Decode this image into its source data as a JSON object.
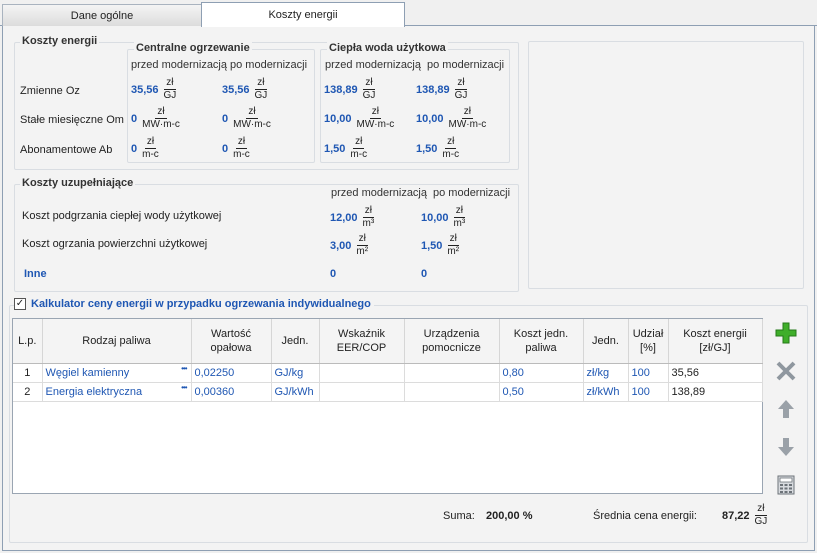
{
  "tabs": [
    {
      "label": "Dane ogólne"
    },
    {
      "label": "Koszty energii"
    }
  ],
  "koszty": {
    "title": "Koszty energii",
    "co_title": "Centralne ogrzewanie",
    "cwu_title": "Ciepła woda użytkowa",
    "przed": "przed modernizacją",
    "po": "po modernizacji",
    "rows": [
      {
        "label": "Zmienne Oz",
        "co_przed": "35,56",
        "co_po": "35,56",
        "cwu_przed": "138,89",
        "cwu_po": "138,89",
        "unit_n": "zł",
        "unit_d": "GJ"
      },
      {
        "label": "Stałe miesięczne Om",
        "co_przed": "0",
        "co_po": "0",
        "cwu_przed": "10,00",
        "cwu_po": "10,00",
        "unit_n": "zł",
        "unit_d": "MW·m-c"
      },
      {
        "label": "Abonamentowe Ab",
        "co_przed": "0",
        "co_po": "0",
        "cwu_przed": "1,50",
        "cwu_po": "1,50",
        "unit_n": "zł",
        "unit_d": "m-c"
      }
    ]
  },
  "uzup": {
    "title": "Koszty uzupełniające",
    "przed": "przed modernizacją",
    "po": "po modernizacji",
    "rows": [
      {
        "label": "Koszt podgrzania ciepłej wody użytkowej",
        "przed": "12,00",
        "po": "10,00",
        "unit_n": "zł",
        "unit_d": "m³"
      },
      {
        "label": "Koszt ogrzania powierzchni użytkowej",
        "przed": "3,00",
        "po": "1,50",
        "unit_n": "zł",
        "unit_d": "m²"
      },
      {
        "label": "Inne",
        "przed": "0",
        "po": "0"
      }
    ]
  },
  "kalk": {
    "checkbox_label": "Kalkulator ceny energii w przypadku ogrzewania indywidualnego",
    "checked": true,
    "columns": [
      "L.p.",
      "Rodzaj paliwa",
      "Wartość opałowa",
      "Jedn.",
      "Wskaźnik EER/COP",
      "Urządzenia pomocnicze",
      "Koszt jedn. paliwa",
      "Jedn.",
      "Udział [%]",
      "Koszt energii [zł/GJ]"
    ],
    "rows": [
      {
        "lp": "1",
        "rodzaj": "Węgiel kamienny",
        "wartosc": "0,02250",
        "jedn": "GJ/kg",
        "eer": "",
        "urz": "",
        "koszt": "0,80",
        "jedn2": "zł/kg",
        "udzial": "100",
        "energia": "35,56"
      },
      {
        "lp": "2",
        "rodzaj": "Energia elektryczna",
        "wartosc": "0,00360",
        "jedn": "GJ/kWh",
        "eer": "",
        "urz": "",
        "koszt": "0,50",
        "jedn2": "zł/kWh",
        "udzial": "100",
        "energia": "138,89"
      }
    ],
    "ellipsis": "•••",
    "suma_label": "Suma:",
    "suma_value": "200,00 %",
    "srednia_label": "Średnia cena energii:",
    "srednia_value": "87,22",
    "srednia_unit_n": "zł",
    "srednia_unit_d": "GJ"
  },
  "icons": {
    "add": "plus-icon",
    "delete": "x-icon",
    "up": "arrow-up-icon",
    "down": "arrow-down-icon",
    "calc": "calculator-icon"
  },
  "colors": {
    "accent_blue": "#1f57b3",
    "add_green": "#3fae2a"
  }
}
